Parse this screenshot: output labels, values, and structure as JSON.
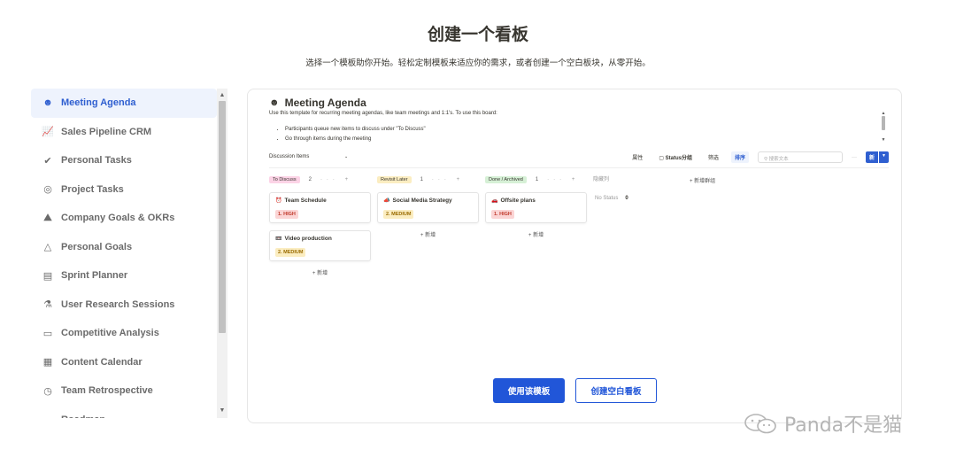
{
  "header": {
    "title": "创建一个看板",
    "subtitle": "选择一个模板助你开始。轻松定制模板来适应你的需求，或者创建一个空白板块，从零开始。"
  },
  "sidebar": {
    "items": [
      {
        "label": "Meeting Agenda",
        "icon": "☻",
        "icon_name": "meeting-icon",
        "active": true
      },
      {
        "label": "Sales Pipeline CRM",
        "icon": "📈",
        "icon_name": "chart-icon"
      },
      {
        "label": "Personal Tasks",
        "icon": "✔",
        "icon_name": "check-icon"
      },
      {
        "label": "Project Tasks",
        "icon": "◎",
        "icon_name": "target-icon"
      },
      {
        "label": "Company Goals & OKRs",
        "icon": "⛰",
        "icon_name": "mountain-icon"
      },
      {
        "label": "Personal Goals",
        "icon": "△",
        "icon_name": "triangle-icon"
      },
      {
        "label": "Sprint Planner",
        "icon": "▤",
        "icon_name": "planner-icon"
      },
      {
        "label": "User Research Sessions",
        "icon": "⚗",
        "icon_name": "research-icon"
      },
      {
        "label": "Competitive Analysis",
        "icon": "▭",
        "icon_name": "folder-icon"
      },
      {
        "label": "Content Calendar",
        "icon": "▦",
        "icon_name": "calendar-icon"
      },
      {
        "label": "Team Retrospective",
        "icon": "◷",
        "icon_name": "clock-icon"
      },
      {
        "label": "Roadmap",
        "icon": "☁",
        "icon_name": "roadmap-icon"
      }
    ]
  },
  "preview": {
    "title": "Meeting Agenda",
    "description": "Use this template for recurring meeting agendas, like team meetings and 1:1's. To use this board:",
    "bullets": [
      "Participants queue new items to discuss under \"To Discuss\"",
      "Go through items during the meeting"
    ],
    "toolbar": {
      "view": "Discussion Items",
      "properties": "属性",
      "group_by": "Status分组",
      "filter": "筛选",
      "sort": "排序",
      "search_placeholder": "搜索文本",
      "more": "···",
      "new": "新"
    },
    "columns": [
      {
        "label": "To Discuss",
        "tag_color": "#fcd3e6",
        "count": "2",
        "ops": "··· +",
        "cards": [
          {
            "title": "Team Schedule",
            "icon": "⏰",
            "priority": "1. HIGH",
            "level": "high"
          },
          {
            "title": "Video production",
            "icon": "📼",
            "priority": "2. MEDIUM",
            "level": "medium"
          }
        ],
        "add": "+ 新增"
      },
      {
        "label": "Revisit Later",
        "tag_color": "#fbedc1",
        "count": "1",
        "ops": "··· +",
        "cards": [
          {
            "title": "Social Media Strategy",
            "icon": "📣",
            "priority": "2. MEDIUM",
            "level": "medium"
          }
        ],
        "add": "+ 新增"
      },
      {
        "label": "Done / Archived",
        "tag_color": "#d6f0d6",
        "count": "1",
        "ops": "··· +",
        "cards": [
          {
            "title": "Offsite plans",
            "icon": "🚗",
            "priority": "1. HIGH",
            "level": "high"
          }
        ],
        "add": "+ 新增"
      }
    ],
    "hidden_columns": "隐藏列",
    "no_status": "No Status",
    "no_status_count": "0",
    "add_group": "+ 新增群组"
  },
  "actions": {
    "use_template": "使用该模板",
    "create_blank": "创建空白看板"
  },
  "watermark": "Panda不是猫",
  "colors": {
    "accent": "#2156d8",
    "active_bg": "#eef3fd"
  }
}
